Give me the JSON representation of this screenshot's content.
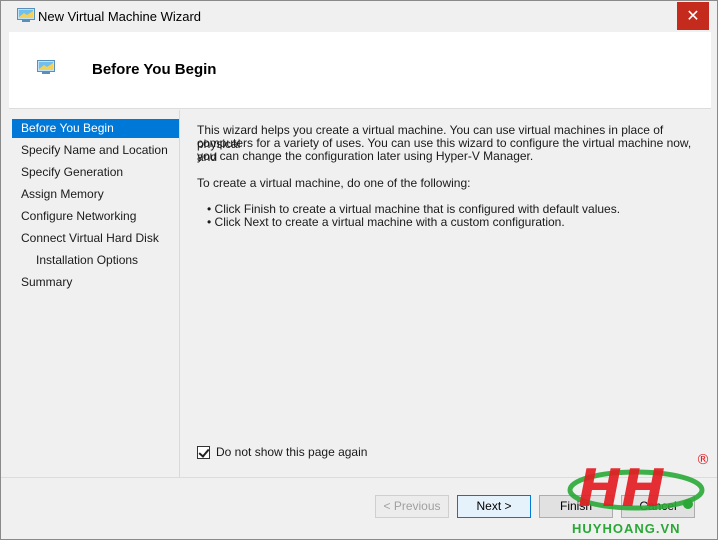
{
  "window": {
    "title": "New Virtual Machine Wizard",
    "close_glyph": "✕"
  },
  "header": {
    "title": "Before You Begin"
  },
  "nav": {
    "items": [
      {
        "label": "Before You Begin",
        "selected": true
      },
      {
        "label": "Specify Name and Location"
      },
      {
        "label": "Specify Generation"
      },
      {
        "label": "Assign Memory"
      },
      {
        "label": "Configure Networking"
      },
      {
        "label": "Connect Virtual Hard Disk"
      },
      {
        "label": "Installation Options",
        "sub": true
      },
      {
        "label": "Summary"
      }
    ]
  },
  "content": {
    "intro_lines": [
      "This wizard helps you create a virtual machine. You can use virtual machines in place of physical",
      "computers for a variety of uses. You can use this wizard to configure the virtual machine now, and",
      "you can change the configuration later using Hyper-V Manager."
    ],
    "instruction": "To create a virtual machine, do one of the following:",
    "bullets": [
      "• Click Finish to create a virtual machine that is configured with default values.",
      "• Click Next to create a virtual machine with a custom configuration."
    ],
    "checkbox_label": "Do not show this page again",
    "checkbox_checked": true
  },
  "footer": {
    "previous": "< Previous",
    "next": "Next >",
    "finish": "Finish",
    "cancel": "Cancel"
  },
  "watermark": {
    "text": "HUYHOANG.VN",
    "registered": "®"
  },
  "colors": {
    "selection": "#0078d7",
    "close": "#c42b1c",
    "watermark_red": "#e31e24",
    "watermark_green": "#2aa836"
  }
}
